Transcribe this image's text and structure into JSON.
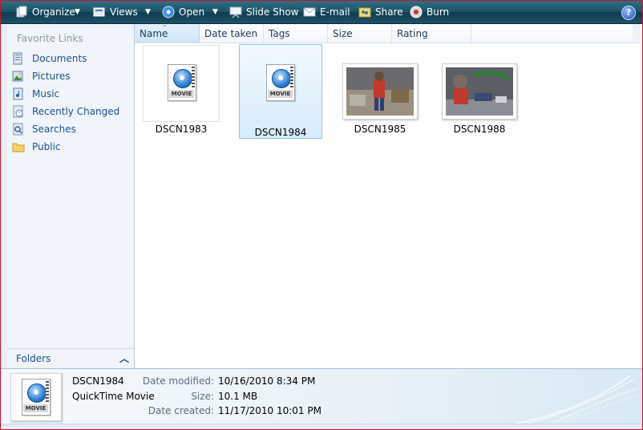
{
  "toolbar": {
    "organize": "Organize",
    "views": "Views",
    "open": "Open",
    "slideshow": "Slide Show",
    "email": "E-mail",
    "share": "Share",
    "burn": "Burn",
    "help": "?"
  },
  "nav": {
    "title": "Favorite Links",
    "items": [
      {
        "label": "Documents",
        "icon": "documents-icon"
      },
      {
        "label": "Pictures",
        "icon": "pictures-icon"
      },
      {
        "label": "Music",
        "icon": "music-icon"
      },
      {
        "label": "Recently Changed",
        "icon": "recently-changed-icon"
      },
      {
        "label": "Searches",
        "icon": "searches-icon"
      },
      {
        "label": "Public",
        "icon": "public-folder-icon"
      }
    ],
    "folders_label": "Folders"
  },
  "columns": [
    "Name",
    "Date taken",
    "Tags",
    "Size",
    "Rating"
  ],
  "files": [
    {
      "name": "DSCN1983",
      "type": "movie",
      "selected": false
    },
    {
      "name": "DSCN1984",
      "type": "movie",
      "selected": true
    },
    {
      "name": "DSCN1985",
      "type": "photo",
      "selected": false
    },
    {
      "name": "DSCN1988",
      "type": "photo",
      "selected": false
    }
  ],
  "movie_tag": "MOVIE",
  "details": {
    "name": "DSCN1984",
    "type": "QuickTime Movie",
    "date_modified_label": "Date modified:",
    "date_modified": "10/16/2010 8:34 PM",
    "size_label": "Size:",
    "size": "10.1 MB",
    "date_created_label": "Date created:",
    "date_created": "11/17/2010 10:01 PM"
  },
  "colors": {
    "toolbar": "#1d5166",
    "selection": "#d6ecfb",
    "link": "#1e4f8f"
  }
}
